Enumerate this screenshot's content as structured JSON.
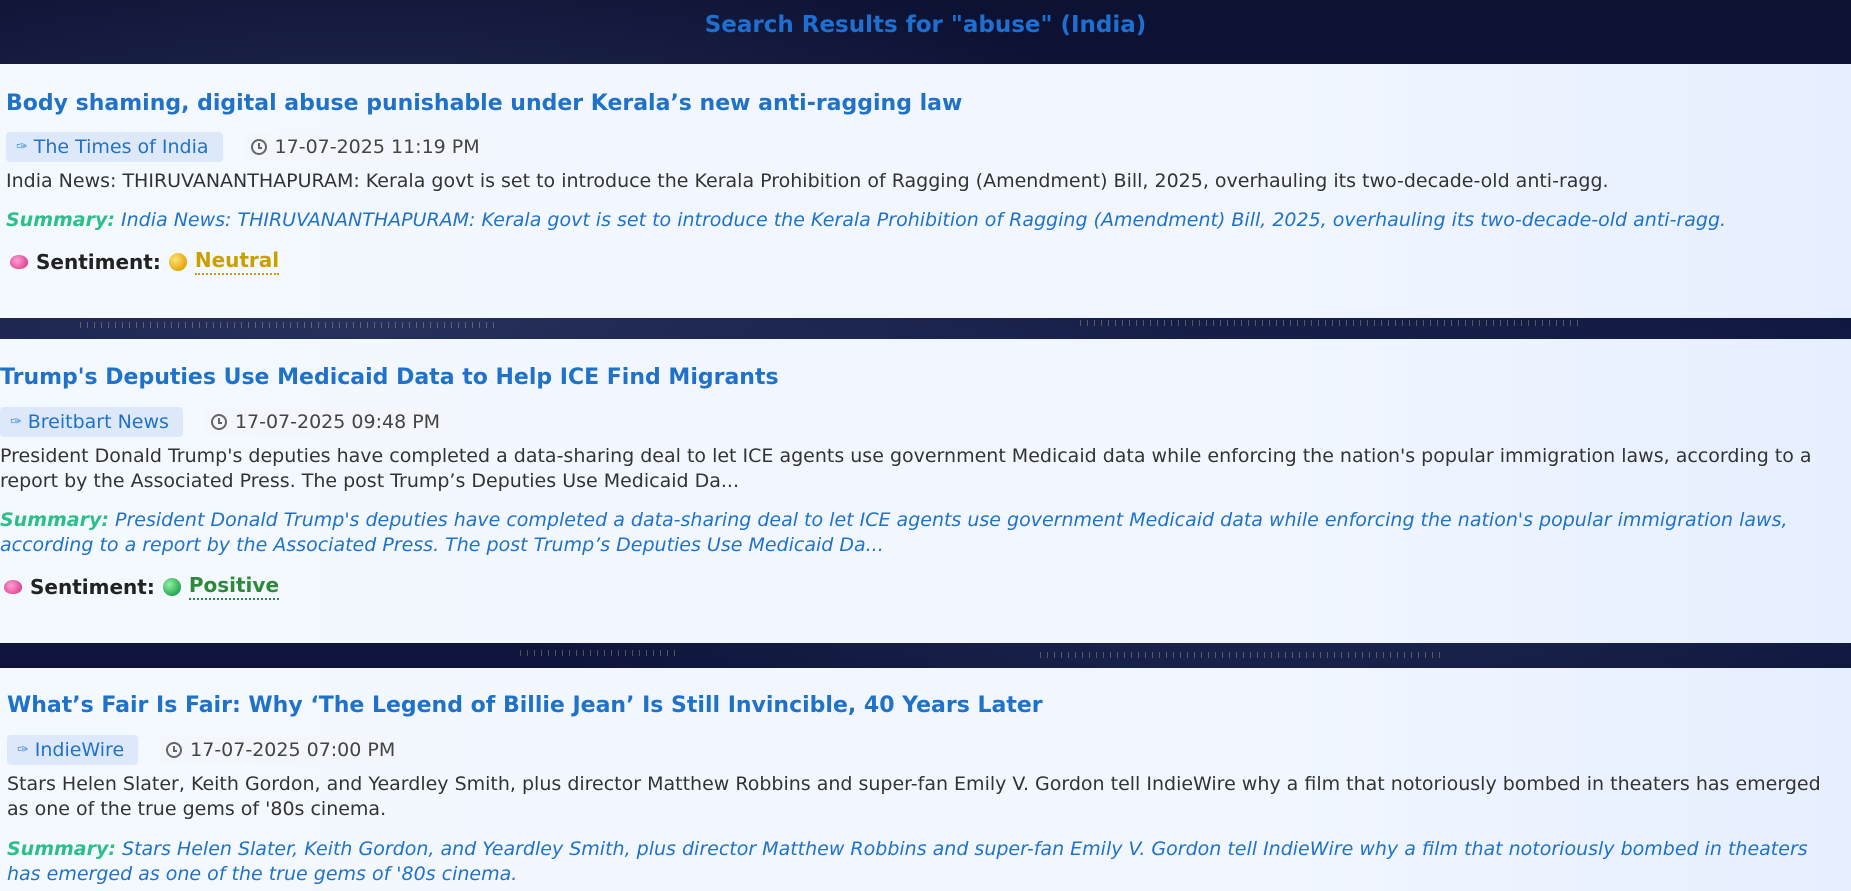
{
  "header": {
    "title": "Search Results for \"abuse\" (India)"
  },
  "articles": [
    {
      "title": "Body shaming, digital abuse punishable under Kerala’s new anti-ragging law",
      "source": "The Times of India",
      "time": "17-07-2025 11:19 PM",
      "description": "India News: THIRUVANANTHAPURAM: Kerala govt is set to introduce the Kerala Prohibition of Ragging (Amendment) Bill, 2025, overhauling its two-decade-old anti-ragg.",
      "summary_label": "Summary:",
      "summary": "India News: THIRUVANANTHAPURAM: Kerala govt is set to introduce the Kerala Prohibition of Ragging (Amendment) Bill, 2025, overhauling its two-decade-old anti-ragg.",
      "sentiment_label": "Sentiment:",
      "sentiment": "Neutral"
    },
    {
      "title": "Trump's Deputies Use Medicaid Data to Help ICE Find Migrants",
      "source": "Breitbart News",
      "time": "17-07-2025 09:48 PM",
      "description": "President Donald Trump's deputies have completed a data-sharing deal to let ICE agents use government Medicaid data while enforcing the nation's popular immigration laws, according to a report by the Associated Press. The post Trump’s Deputies Use Medicaid Da...",
      "summary_label": "Summary:",
      "summary": "President Donald Trump's deputies have completed a data-sharing deal to let ICE agents use government Medicaid data while enforcing the nation's popular immigration laws, according to a report by the Associated Press. The post Trump’s Deputies Use Medicaid Da...",
      "sentiment_label": "Sentiment:",
      "sentiment": "Positive"
    },
    {
      "title": "What’s Fair Is Fair: Why ‘The Legend of Billie Jean’ Is Still Invincible, 40 Years Later",
      "source": "IndieWire",
      "time": "17-07-2025 07:00 PM",
      "description": "Stars Helen Slater, Keith Gordon, and Yeardley Smith, plus director Matthew Robbins and super-fan Emily V. Gordon tell IndieWire why a film that notoriously bombed in theaters has emerged as one of the true gems of '80s cinema.",
      "summary_label": "Summary:",
      "summary": "Stars Helen Slater, Keith Gordon, and Yeardley Smith, plus director Matthew Robbins and super-fan Emily V. Gordon tell IndieWire why a film that notoriously bombed in theaters has emerged as one of the true gems of '80s cinema."
    }
  ],
  "colors": {
    "accent": "#1f72c8",
    "summary_label": "#2cbf88",
    "neutral": "#c9a000",
    "positive": "#2d8a3a"
  },
  "icons": {
    "source": "pen-icon",
    "time": "clock-icon",
    "sentiment": "brain-icon"
  }
}
